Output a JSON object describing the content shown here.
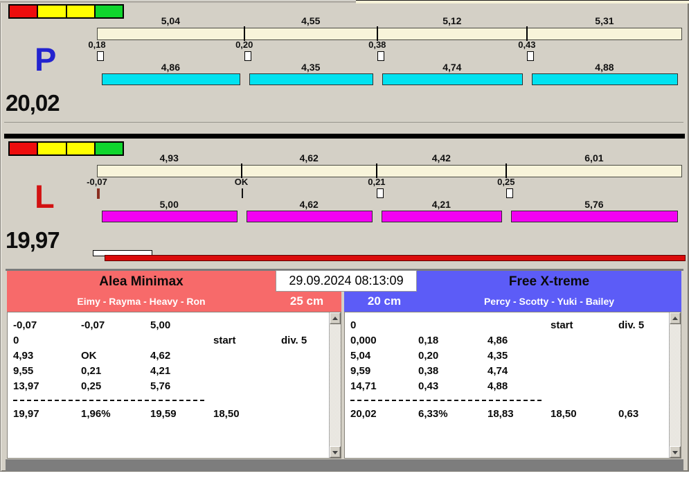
{
  "window": {
    "background": "#d4d0c6"
  },
  "datetime": "29.09.2024 08:13:09",
  "traffic_light": {
    "colors": [
      "#ee0d0d",
      "#ffff00",
      "#ffff00",
      "#0fd52d"
    ]
  },
  "lanes": [
    {
      "letter": "P",
      "letter_color": "#2323cf",
      "total_label": "20,02",
      "total_value": 20.02,
      "split_bar_color": "#f8f4da",
      "run_bar_color": "#00e2f0",
      "splits": [
        {
          "label": "5,04",
          "value": 5.04
        },
        {
          "label": "4,55",
          "value": 4.55
        },
        {
          "label": "5,12",
          "value": 5.12
        },
        {
          "label": "5,31",
          "value": 5.31
        }
      ],
      "gaps": [
        {
          "label": "0,18",
          "marker": "box"
        },
        {
          "label": "0,20",
          "marker": "box"
        },
        {
          "label": "0,38",
          "marker": "box"
        },
        {
          "label": "0,43",
          "marker": "box"
        }
      ],
      "runs": [
        {
          "label": "4,86",
          "value": 4.86
        },
        {
          "label": "4,35",
          "value": 4.35
        },
        {
          "label": "4,74",
          "value": 4.74
        },
        {
          "label": "4,88",
          "value": 4.88
        }
      ]
    },
    {
      "letter": "L",
      "letter_color": "#d21212",
      "total_label": "19,97",
      "total_value": 19.97,
      "split_bar_color": "#f8f4da",
      "run_bar_color": "#f200f2",
      "splits": [
        {
          "label": "4,93",
          "value": 4.93
        },
        {
          "label": "4,62",
          "value": 4.62
        },
        {
          "label": "4,42",
          "value": 4.42
        },
        {
          "label": "6,01",
          "value": 6.01
        }
      ],
      "gaps": [
        {
          "label": "-0,07",
          "marker": "red-tick"
        },
        {
          "label": "OK",
          "marker": "black-tick"
        },
        {
          "label": "0,21",
          "marker": "box"
        },
        {
          "label": "0,25",
          "marker": "box"
        }
      ],
      "runs": [
        {
          "label": "5,00",
          "value": 5.0
        },
        {
          "label": "4,62",
          "value": 4.62
        },
        {
          "label": "4,21",
          "value": 4.21
        },
        {
          "label": "5,76",
          "value": 5.76
        }
      ]
    }
  ],
  "progress": {
    "white_bar_color": "#ffffff",
    "red_bar_color": "#da0b0b"
  },
  "teams": [
    {
      "name": "Alea Minimax",
      "members": "Eimy - Rayma - Heavy - Ron",
      "height": "25 cm",
      "header_color": "#f76a6a",
      "rows": [
        [
          "-0,07",
          "-0,07",
          "5,00",
          "",
          ""
        ],
        [
          "0",
          "",
          "",
          "start",
          "div. 5"
        ],
        [
          "4,93",
          "OK",
          "4,62",
          "",
          ""
        ],
        [
          "9,55",
          "0,21",
          "4,21",
          "",
          ""
        ],
        [
          "13,97",
          "0,25",
          "5,76",
          "",
          ""
        ]
      ],
      "total_row": [
        "19,97",
        "1,96%",
        "19,59",
        "18,50",
        ""
      ]
    },
    {
      "name": "Free X-treme",
      "members": "Percy - Scotty - Yuki - Bailey",
      "height": "20 cm",
      "header_color": "#5c5cf7",
      "rows": [
        [
          "0",
          "",
          "",
          "start",
          "div. 5"
        ],
        [
          "0,000",
          "0,18",
          "4,86",
          "",
          ""
        ],
        [
          "5,04",
          "0,20",
          "4,35",
          "",
          ""
        ],
        [
          "9,59",
          "0,38",
          "4,74",
          "",
          ""
        ],
        [
          "14,71",
          "0,43",
          "4,88",
          "",
          ""
        ]
      ],
      "total_row": [
        "20,02",
        "6,33%",
        "18,83",
        "18,50",
        "0,63"
      ]
    }
  ]
}
